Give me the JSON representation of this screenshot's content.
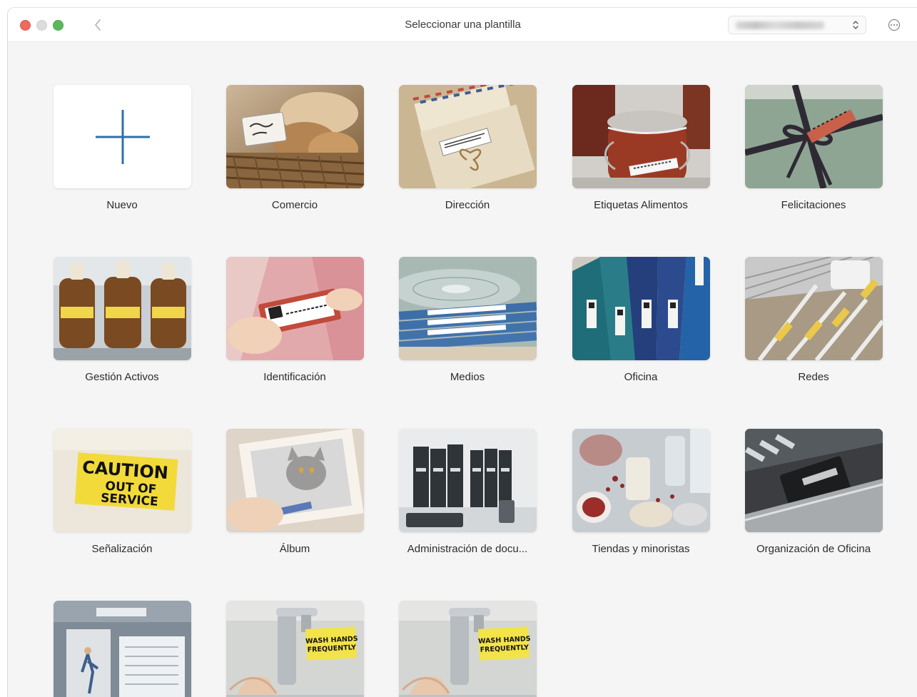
{
  "window": {
    "title": "Seleccionar una plantilla",
    "printer_select": {
      "value": ""
    }
  },
  "colors": {
    "close": "#ee6a5e",
    "minimize": "#dcdcdc",
    "zoom": "#5cb85c",
    "plus": "#2f6fae"
  },
  "templates": [
    {
      "label": "Nuevo",
      "icon": "plus-icon"
    },
    {
      "label": "Comercio",
      "icon": "bread-basket-photo"
    },
    {
      "label": "Dirección",
      "icon": "envelopes-photo"
    },
    {
      "label": "Etiquetas Alimentos",
      "icon": "jam-jar-photo"
    },
    {
      "label": "Felicitaciones",
      "icon": "gift-box-photo"
    },
    {
      "label": "Gestión Activos",
      "icon": "bottles-photo"
    },
    {
      "label": "Identificación",
      "icon": "name-badge-photo"
    },
    {
      "label": "Medios",
      "icon": "disc-cases-photo"
    },
    {
      "label": "Oficina",
      "icon": "binders-photo"
    },
    {
      "label": "Redes",
      "icon": "cables-photo"
    },
    {
      "label": "Señalización",
      "icon": "caution-sign-photo"
    },
    {
      "label": "Álbum",
      "icon": "cat-photo"
    },
    {
      "label": "Administración de docu...",
      "icon": "document-binders-photo"
    },
    {
      "label": "Tiendas y minoristas",
      "icon": "spice-jars-photo"
    },
    {
      "label": "Organización de Oficina",
      "icon": "office-drawer-photo"
    },
    {
      "label": "",
      "icon": "bulletin-board-photo"
    },
    {
      "label": "",
      "icon": "hand-washing-photo"
    },
    {
      "label": "",
      "icon": "hand-washing-photo"
    }
  ],
  "caution_sign": {
    "line1": "CAUTION",
    "line2": "OUT OF",
    "line3": "SERVICE"
  },
  "wash_sign": {
    "line1": "WASH HANDS",
    "line2": "FREQUENTLY"
  }
}
